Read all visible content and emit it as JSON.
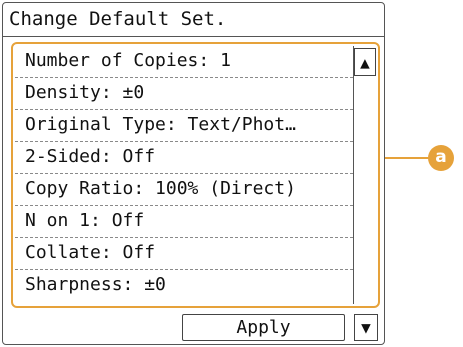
{
  "title": "Change Default Set.",
  "settings_list": [
    {
      "label": "Number of Copies:  1"
    },
    {
      "label": "Density: ±0"
    },
    {
      "label": "Original Type: Text/Phot…"
    },
    {
      "label": "2-Sided: Off"
    },
    {
      "label": "Copy Ratio: 100% (Direct)"
    },
    {
      "label": "N on 1: Off"
    },
    {
      "label": "Collate: Off"
    },
    {
      "label": "Sharpness: ±0"
    }
  ],
  "apply_button": "Apply",
  "callout_label": "a",
  "icons": {
    "scroll_up": "triangle-up-icon",
    "scroll_down": "triangle-down-icon"
  },
  "colors": {
    "highlight": "#e6a23a"
  }
}
